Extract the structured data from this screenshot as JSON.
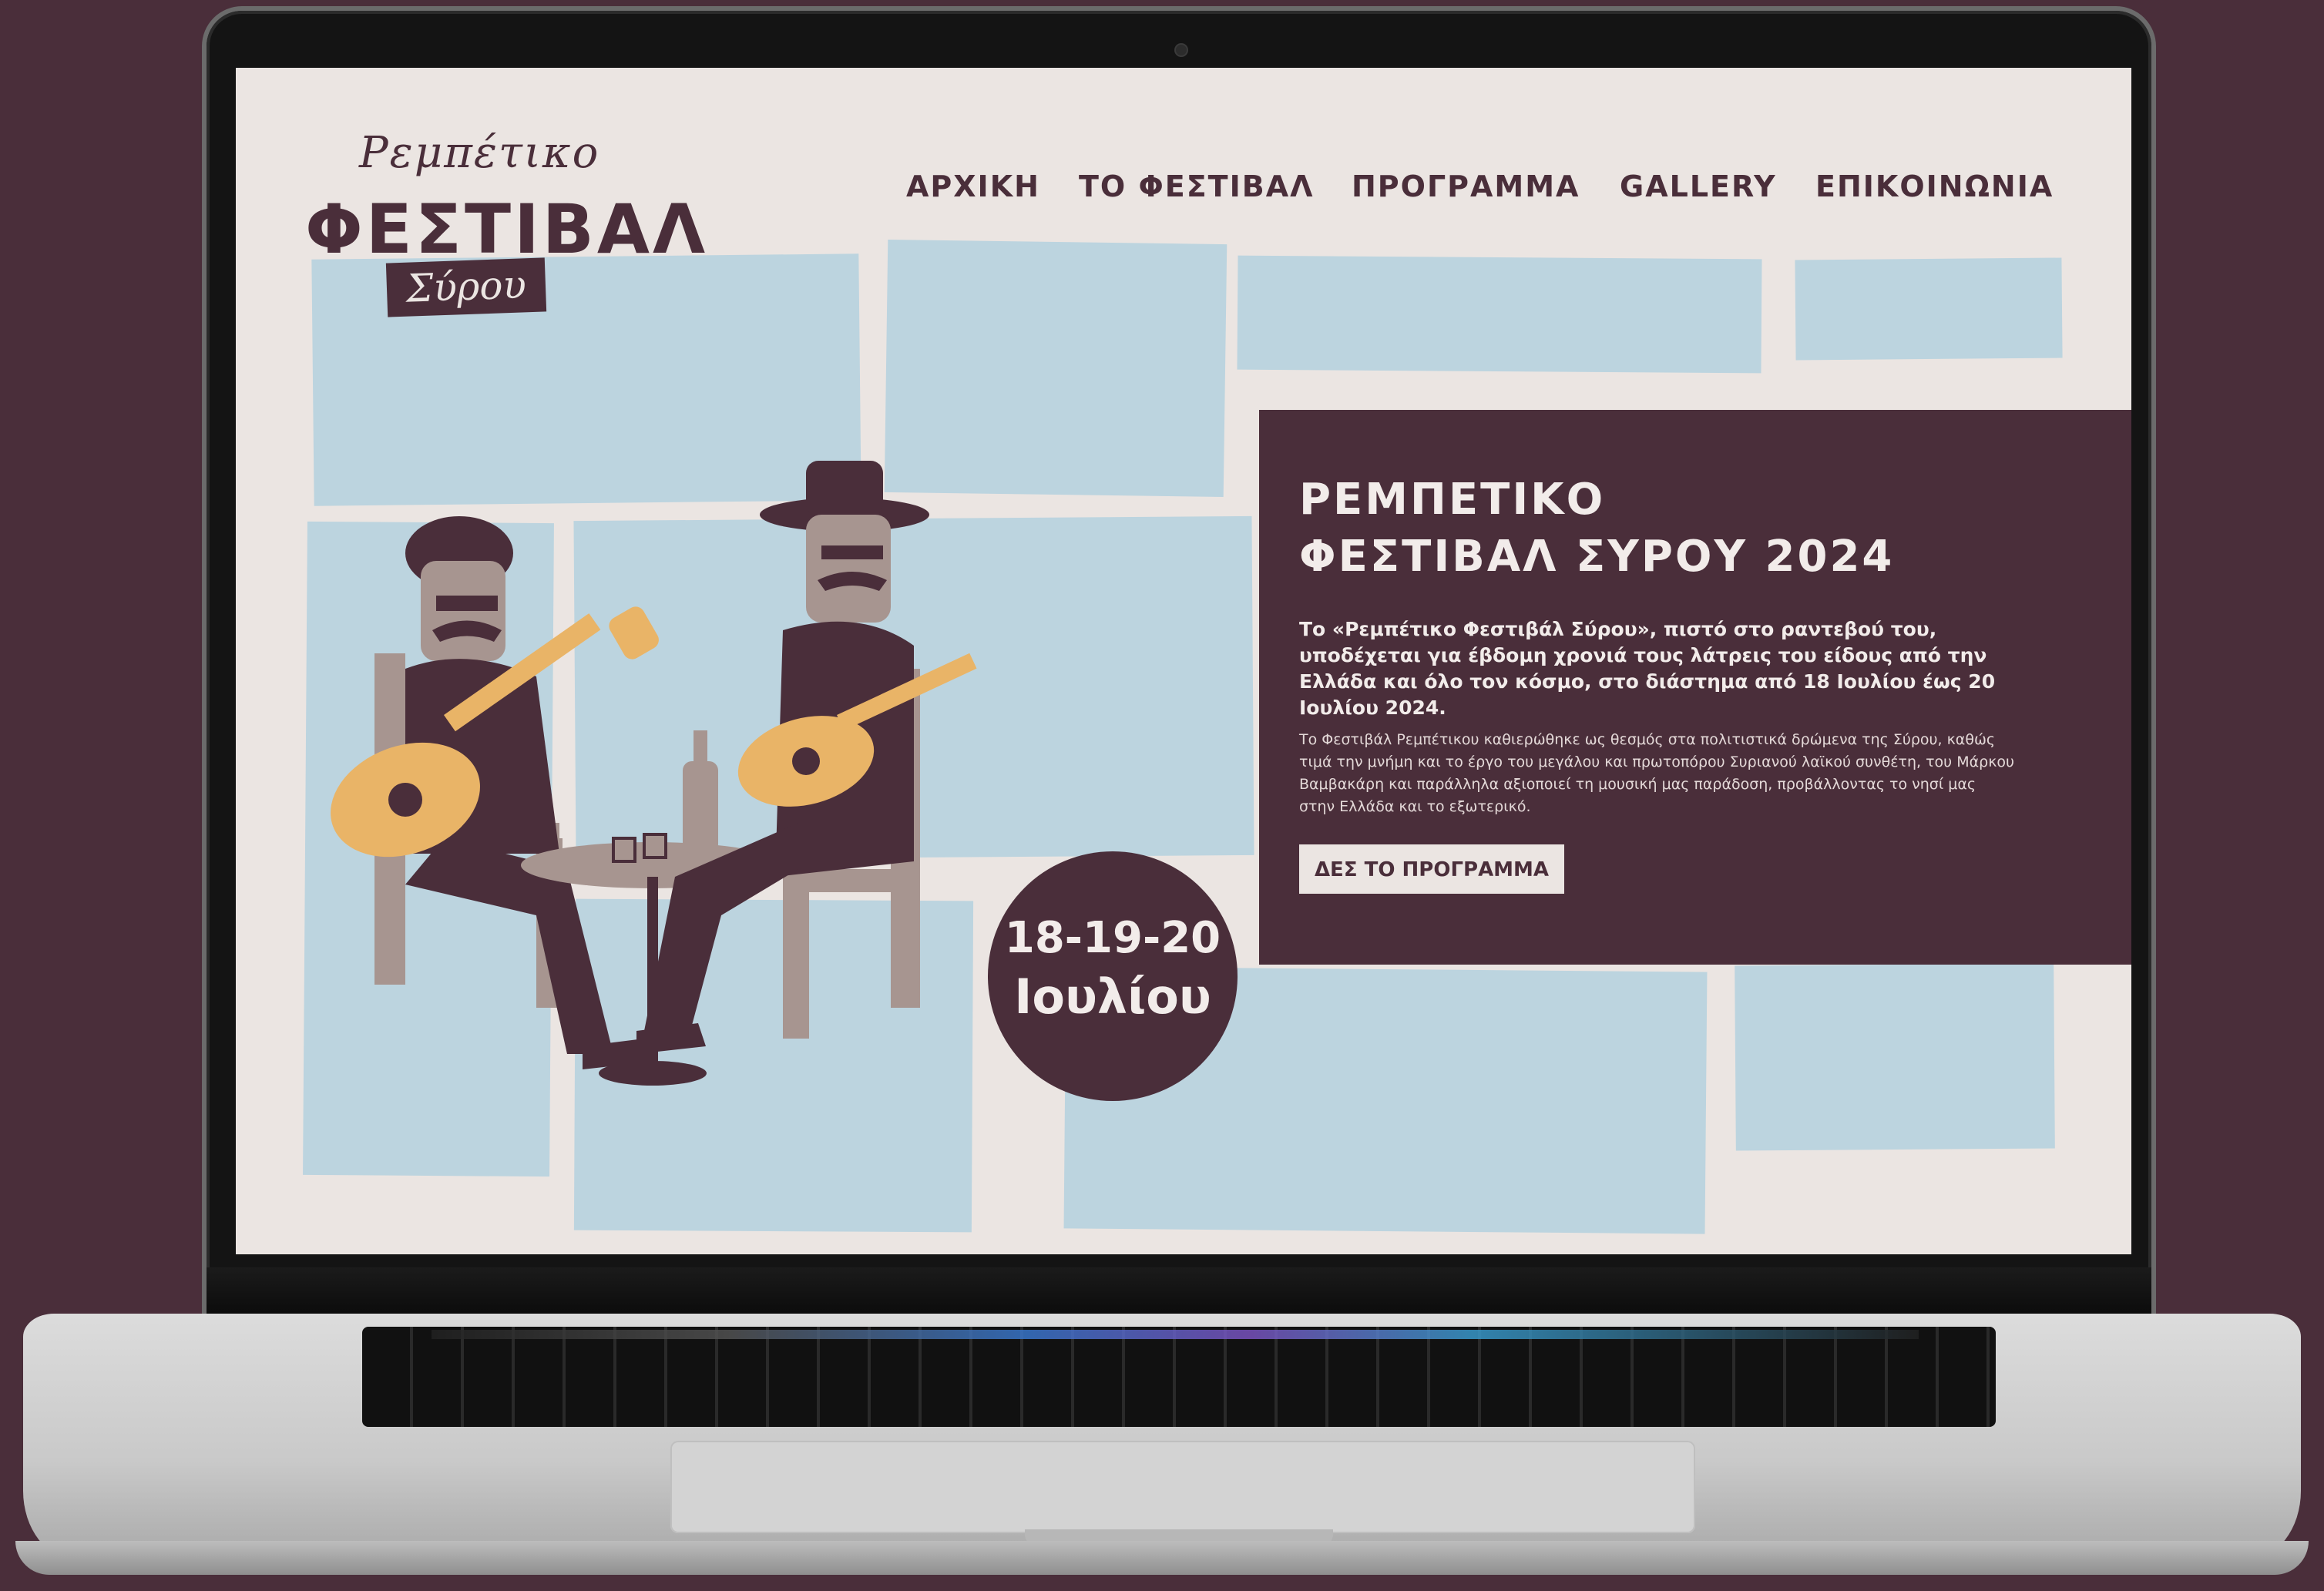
{
  "site": {
    "logo": {
      "top": "Ρεμπέτικο",
      "main": "ΦΕΣΤΙΒΑΛ",
      "badge": "Σύρου"
    },
    "nav": [
      {
        "label": "ΑΡΧΙΚΗ"
      },
      {
        "label": "ΤΟ ΦΕΣΤΙΒΑΛ"
      },
      {
        "label": "ΠΡΟΓΡΑΜΜΑ"
      },
      {
        "label": "GALLERY"
      },
      {
        "label": "ΕΠΙΚΟΙΝΩΝΙΑ"
      }
    ],
    "hero": {
      "title_line1": "ΡΕΜΠΕΤΙΚΟ",
      "title_line2": "ΦΕΣΤΙΒΑΛ ΣΥΡΟΥ 2024",
      "lead": "Το «Ρεμπέτικο Φεστιβάλ Σύρου», πιστό στο ραντεβού του, υποδέχεται για έβδομη χρονιά τους λάτρεις του είδους από την Ελλάδα και όλο τον κόσμο, στο διάστημα από 18 Ιουλίου έως 20 Ιουλίου 2024.",
      "body": "Το Φεστιβάλ Ρεμπέτικου καθιερώθηκε ως θεσμός στα πολιτιστικά δρώμενα της Σύρου, καθώς τιμά την μνήμη και το έργο του μεγάλου και πρωτοπόρου Συριανού λαϊκού συνθέτη, του Μάρκου Βαμβακάρη και παράλληλα αξιοποιεί τη μουσική μας παράδοση, προβάλλοντας το νησί μας στην Ελλάδα και το εξωτερικό.",
      "button": "ΔΕΣ ΤΟ ΠΡΟΓΡΑΜΜΑ"
    },
    "date_badge": {
      "line1": "18-19-20",
      "line2": "Ιουλίου"
    }
  },
  "colors": {
    "plum": "#4a2e3a",
    "cream": "#ebe5e2",
    "sky": "#bcd4df",
    "mustard": "#e9b467",
    "taupe": "#a79590"
  }
}
